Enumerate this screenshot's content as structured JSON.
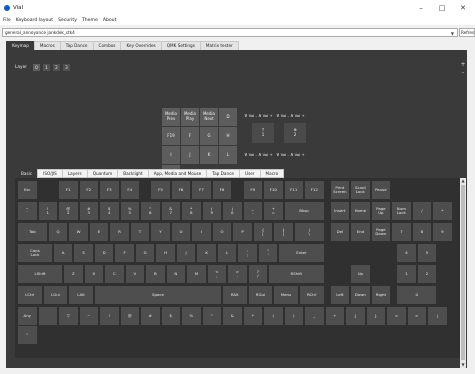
{
  "window": {
    "title": "Vial",
    "minimize": "–",
    "maximize": "□",
    "close": "✕"
  },
  "menu": [
    "File",
    "Keyboard layout",
    "Security",
    "Theme",
    "About"
  ],
  "device": {
    "selected": "general_annoyance jankdek_stk4",
    "refresh": "Refresh"
  },
  "main_tabs": [
    "Keymap",
    "Macros",
    "Tap Dance",
    "Combos",
    "Key Overrides",
    "QMK Settings",
    "Matrix tester"
  ],
  "layer": {
    "label": "Layer",
    "buttons": [
      "0",
      "1",
      "2",
      "3"
    ],
    "plus": "+",
    "minus": "-"
  },
  "keymap": {
    "rows": [
      [
        "Media\nPrev",
        "Media\nPlay",
        "Media\nNext",
        "D"
      ],
      [
        "F19",
        "F",
        "G",
        "H"
      ],
      [
        "I",
        "J",
        "K",
        "L"
      ],
      [
        "MO(1)",
        "MO(2)",
        "MO(1)",
        "M"
      ]
    ],
    "encoder_left": [
      "Vol -",
      "Vol +"
    ],
    "encoder_right": [
      "Vol -",
      "Vol +"
    ],
    "enc_keys_top": [
      "↑\n1",
      "⊕\n2"
    ],
    "enc_keys_bottom": [
      "#\n3",
      "$\n4"
    ]
  },
  "bottom_tabs": [
    "Basic",
    "ISO/JIS",
    "Layers",
    "Quantum",
    "Backlight",
    "App, Media and Mouse",
    "Tap Dance",
    "User",
    "Macro"
  ],
  "keys": {
    "r1": [
      "Esc",
      "F1",
      "F2",
      "F3",
      "F4",
      "F5",
      "F6",
      "F7",
      "F8",
      "F9",
      "F10",
      "F11",
      "F12",
      "Print\nScreen",
      "Scroll\nLock",
      "Pause"
    ],
    "r2": [
      "~\n`",
      "!\n1",
      "@\n2",
      "#\n3",
      "$\n4",
      "%\n5",
      "^\n6",
      "&\n7",
      "*\n8",
      "(\n9",
      ")\n0",
      "_\n-",
      "+\n=",
      "Bksp",
      "Insert",
      "Home",
      "Page\nUp",
      "Num\nLock",
      "/",
      "*",
      "-"
    ],
    "r3": [
      "Tab",
      "Q",
      "W",
      "E",
      "R",
      "T",
      "Y",
      "U",
      "I",
      "O",
      "P",
      "{\n[",
      "}\n]",
      "|\n\\",
      "Del",
      "End",
      "Page\nDown",
      "7",
      "8",
      "9",
      "+"
    ],
    "r4": [
      "Caps\nLock",
      "A",
      "S",
      "D",
      "F",
      "G",
      "H",
      "J",
      "K",
      "L",
      ":\n;",
      "\"\n'",
      "Enter",
      "4",
      "5",
      "6",
      ","
    ],
    "r5": [
      "LShift",
      "Z",
      "X",
      "C",
      "V",
      "B",
      "N",
      "M",
      "<\n,",
      ">\n.",
      "?\n/",
      "RShift",
      "Up",
      "1",
      "2",
      "3",
      "="
    ],
    "r6": [
      "LCtrl",
      "LGui",
      "LAlt",
      "Space",
      "RAlt",
      "RGui",
      "Menu",
      "RCtrl",
      "Left",
      "Down",
      "Right",
      "0",
      ".",
      "Num\nEnter"
    ],
    "r7": [
      "Any",
      "",
      "▽",
      "~",
      "!",
      "@",
      "#",
      "$",
      "%",
      "^",
      "&",
      "*",
      "(",
      ")",
      "_",
      "+",
      "{",
      "}",
      "<",
      ">",
      "|",
      "?"
    ],
    "r8": [
      "\""
    ]
  }
}
